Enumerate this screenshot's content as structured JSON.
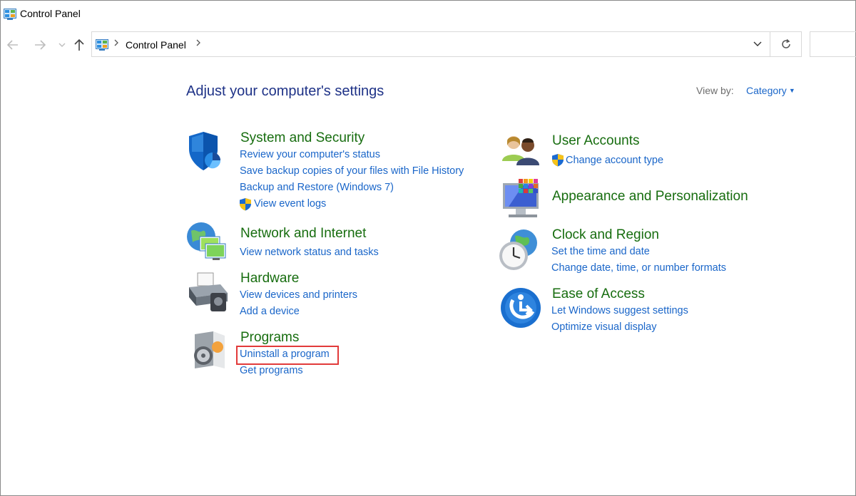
{
  "window": {
    "title": "Control Panel"
  },
  "address_bar": {
    "crumb": "Control Panel"
  },
  "main": {
    "heading": "Adjust your computer's settings",
    "view_by_label": "View by:",
    "view_by_value": "Category"
  },
  "categories": {
    "system_security": {
      "title": "System and Security",
      "links": [
        "Review your computer's status",
        "Save backup copies of your files with File History",
        "Backup and Restore (Windows 7)",
        "View event logs"
      ]
    },
    "network": {
      "title": "Network and Internet",
      "links": [
        "View network status and tasks"
      ]
    },
    "hardware": {
      "title": "Hardware",
      "links": [
        "View devices and printers",
        "Add a device"
      ]
    },
    "programs": {
      "title": "Programs",
      "links": [
        "Uninstall a program",
        "Get programs"
      ]
    },
    "user_accounts": {
      "title": "User Accounts",
      "links": [
        "Change account type"
      ]
    },
    "appearance": {
      "title": "Appearance and Personalization"
    },
    "clock": {
      "title": "Clock and Region",
      "links": [
        "Set the time and date",
        "Change date, time, or number formats"
      ]
    },
    "ease": {
      "title": "Ease of Access",
      "links": [
        "Let Windows suggest settings",
        "Optimize visual display"
      ]
    }
  },
  "icons": {
    "app": "control-panel-icon",
    "back": "back-arrow-icon",
    "forward": "forward-arrow-icon",
    "recent": "chevron-down-icon",
    "up": "up-arrow-icon",
    "refresh": "refresh-icon",
    "uac": "uac-shield-icon"
  },
  "colors": {
    "heading": "#1e3287",
    "category": "#176d0f",
    "link": "#1a66c9",
    "highlight": "#e23a3a"
  }
}
